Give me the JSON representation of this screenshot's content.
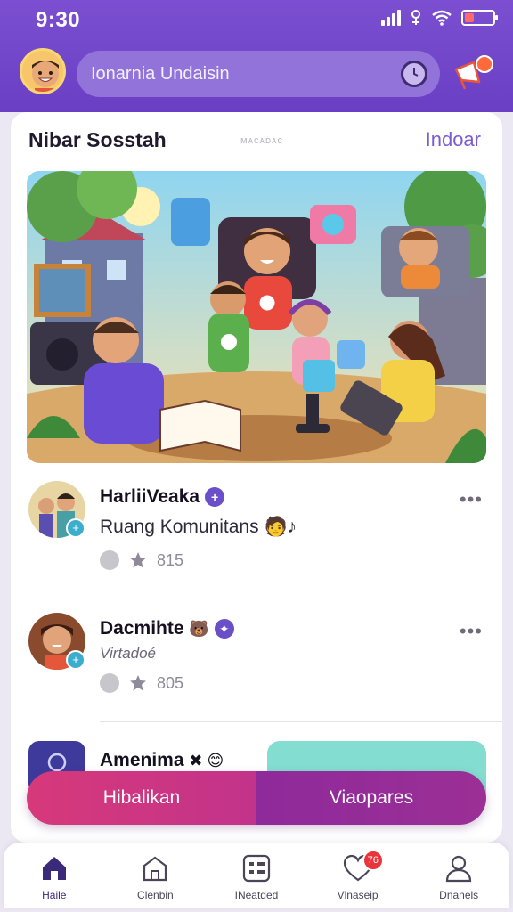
{
  "status_bar": {
    "time": "9:30"
  },
  "header": {
    "search_text": "Ionarnia Undaisin",
    "notification_badge": ""
  },
  "feed": {
    "title": "Nibar Sosstah",
    "subtitle": "ᴍᴀᴄᴀᴅᴀᴄ",
    "action": "Indoar"
  },
  "posts": [
    {
      "name": "HarliiVeaka",
      "verified": "+",
      "text": "Ruang Komunitans 🧑♪",
      "count": "815"
    },
    {
      "name": "Dacmihte",
      "verified": "✦",
      "sub": "Virtadoé",
      "count": "805"
    },
    {
      "name": "Amenima",
      "badges": "✖ 😊"
    }
  ],
  "tabs": {
    "left": "Hibalikan",
    "right": "Viaopares"
  },
  "nav": {
    "items": [
      {
        "label": "Haile",
        "icon": "home-icon"
      },
      {
        "label": "Clenbin",
        "icon": "building-icon"
      },
      {
        "label": "INeatded",
        "icon": "grid-icon"
      },
      {
        "label": "Vlnaseip",
        "icon": "heart-icon",
        "badge": "76"
      },
      {
        "label": "Dnanels",
        "icon": "profile-icon"
      }
    ]
  },
  "colors": {
    "primary": "#7b4fd0",
    "accent": "#d7397a",
    "teal": "#83ddd0"
  }
}
